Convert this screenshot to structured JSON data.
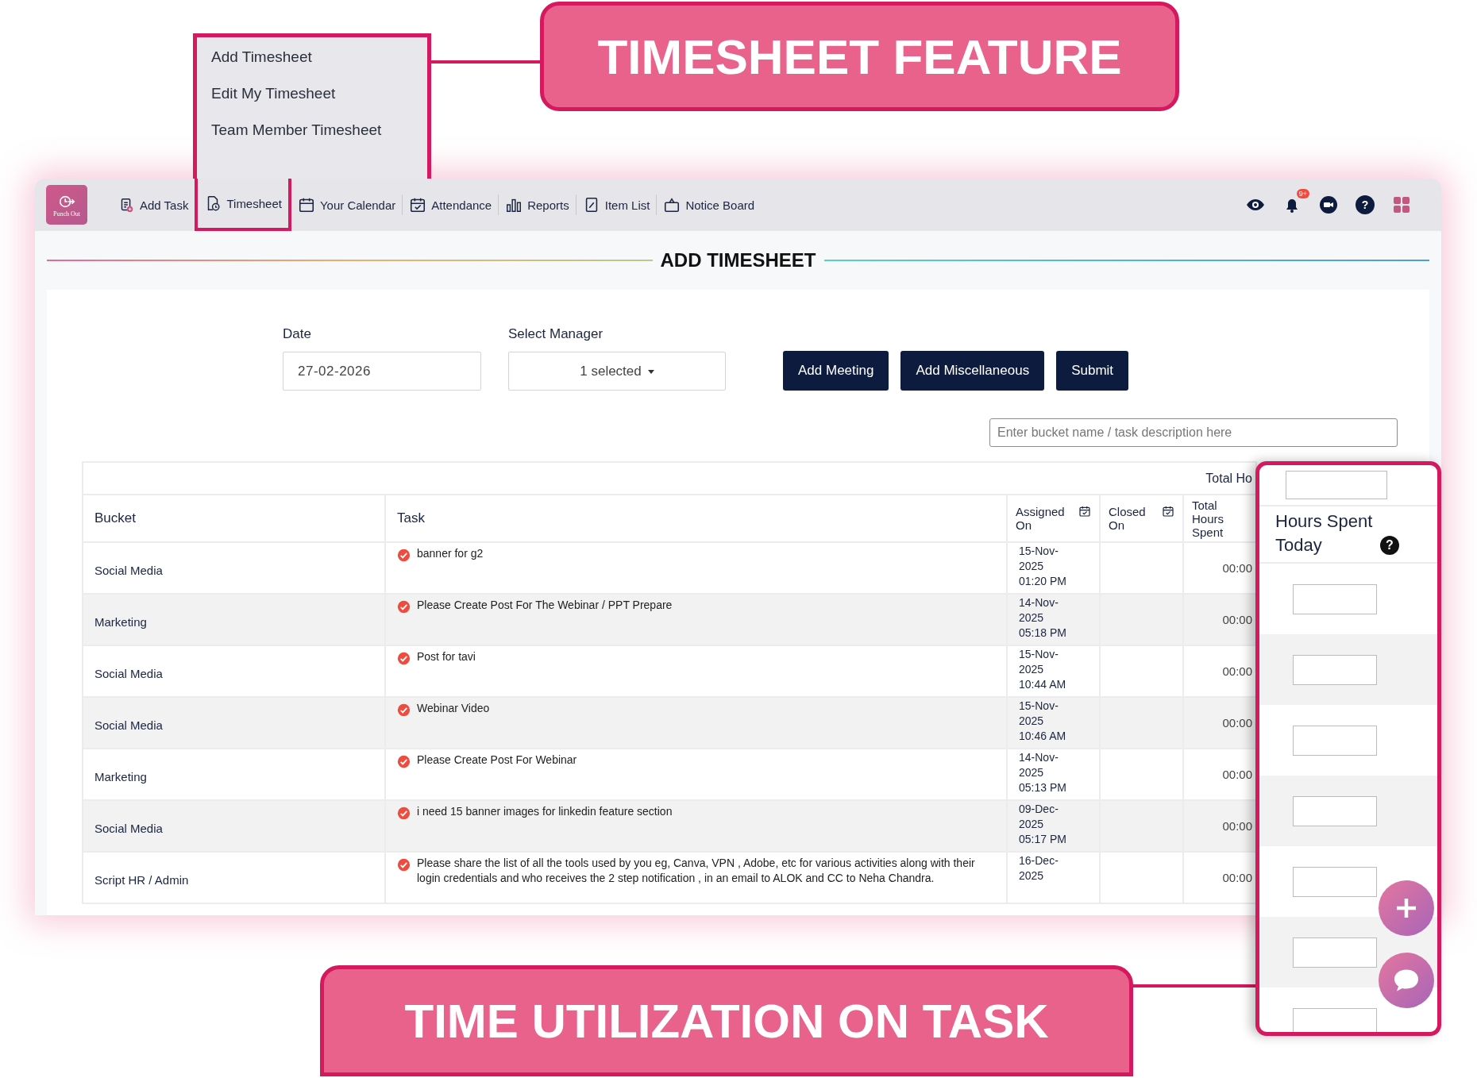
{
  "feature_banner": {
    "text": "TIMESHEET FEATURE"
  },
  "timesheet_menu": {
    "items": [
      "Add Timesheet",
      "Edit My Timesheet",
      "Team Member Timesheet"
    ]
  },
  "navbar": {
    "logo_label": "Punch Out",
    "items": [
      {
        "label": "Add Task",
        "selected": false
      },
      {
        "label": "Timesheet",
        "selected": true
      },
      {
        "label": "Your Calendar",
        "selected": false
      },
      {
        "label": "Attendance",
        "selected": false
      },
      {
        "label": "Reports",
        "selected": false
      },
      {
        "label": "Item List",
        "selected": false
      },
      {
        "label": "Notice Board",
        "selected": false
      }
    ],
    "notification_badge": "9+",
    "help_mark": "?"
  },
  "page_title": "ADD TIMESHEET",
  "form": {
    "date": {
      "label": "Date",
      "value": "27-02-2026"
    },
    "manager": {
      "label": "Select Manager",
      "value": "1 selected"
    },
    "buttons": [
      "Add Meeting",
      "Add Miscellaneous",
      "Submit"
    ],
    "search": {
      "placeholder": "Enter bucket name / task description here"
    }
  },
  "table": {
    "total_label": "Total Ho",
    "columns": [
      {
        "label": "Bucket",
        "kind": "text"
      },
      {
        "label": "Task",
        "kind": "text"
      },
      {
        "label": "Assigned On",
        "kind": "date"
      },
      {
        "label": "Closed On",
        "kind": "date"
      },
      {
        "label": "Total Hours Spent",
        "kind": "number"
      }
    ],
    "rows": [
      {
        "bucket": "Social Media",
        "task": "banner for g2",
        "assigned_on": "15-Nov-2025",
        "assigned_time": "01:20 PM",
        "total_hours": "00:00"
      },
      {
        "bucket": "Marketing",
        "task": "Please Create Post For The Webinar / PPT Prepare",
        "assigned_on": "14-Nov-2025",
        "assigned_time": "05:18 PM",
        "total_hours": "00:00"
      },
      {
        "bucket": "Social Media",
        "task": "Post for tavi",
        "assigned_on": "15-Nov-2025",
        "assigned_time": "10:44 AM",
        "total_hours": "00:00"
      },
      {
        "bucket": "Social Media",
        "task": "Webinar Video",
        "assigned_on": "15-Nov-2025",
        "assigned_time": "10:46 AM",
        "total_hours": "00:00"
      },
      {
        "bucket": "Marketing",
        "task": "Please Create Post For Webinar",
        "assigned_on": "14-Nov-2025",
        "assigned_time": "05:13 PM",
        "total_hours": "00:00"
      },
      {
        "bucket": "Social Media",
        "task": "i need 15 banner images for linkedin feature section",
        "assigned_on": "09-Dec-2025",
        "assigned_time": "05:17 PM",
        "total_hours": "00:00"
      },
      {
        "bucket": "Script HR / Admin",
        "task": "Please share the list of all the tools used by you eg, Canva, VPN , Adobe, etc for various activities along with their login credentials and who receives the 2 step notification , in an email to ALOK and CC to Neha Chandra.",
        "assigned_on": "16-Dec-2025",
        "total_hours": "00:00"
      }
    ]
  },
  "detail_panel": {
    "column_heading": "Hours Spent Today",
    "help_mark": "?"
  },
  "detail_banner": {
    "text": "TIME UTILIZATION ON TASK"
  }
}
